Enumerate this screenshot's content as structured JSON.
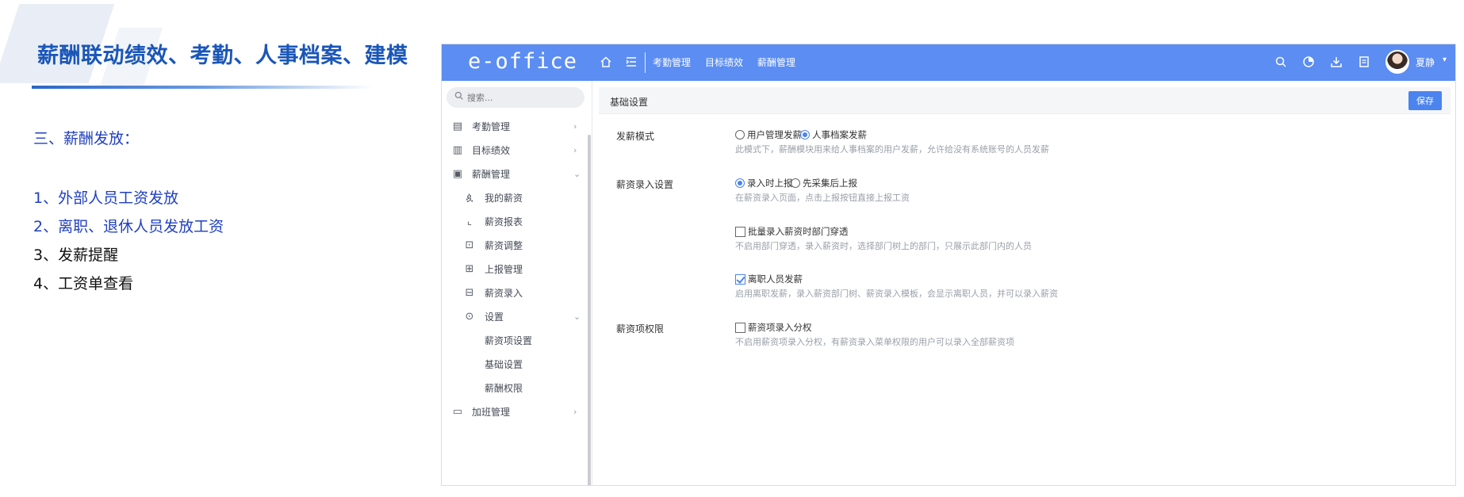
{
  "slide": {
    "title": "薪酬联动绩效、考勤、人事档案、建模",
    "section_heading": "三、薪酬发放：",
    "points": [
      {
        "text": "1、外部人员工资发放",
        "color": "#2040c0"
      },
      {
        "text": "2、离职、退休人员发放工资",
        "color": "#2040c0"
      },
      {
        "text": "3、发薪提醒",
        "color": "#111111"
      },
      {
        "text": "4、工资单查看",
        "color": "#111111"
      }
    ]
  },
  "app": {
    "logo": "e-office",
    "accent_color": "#5b8df2",
    "topbar": {
      "nav": [
        "考勤管理",
        "目标绩效",
        "薪酬管理"
      ],
      "icons": [
        "home-icon",
        "menu-list-icon",
        "search-icon",
        "pie-chart-icon",
        "download-icon",
        "document-icon"
      ],
      "username": "夏静",
      "caret": "▾"
    },
    "sidebar": {
      "search_placeholder": "搜索...",
      "items": [
        {
          "label": "考勤管理",
          "icon": "clipboard-icon",
          "arrow": "›"
        },
        {
          "label": "目标绩效",
          "icon": "bar-chart-icon",
          "arrow": "›"
        },
        {
          "label": "薪酬管理",
          "icon": "wallet-icon",
          "arrow": "⌄"
        },
        {
          "label": "我的薪资",
          "icon": "user-icon"
        },
        {
          "label": "薪资报表",
          "icon": "line-chart-icon"
        },
        {
          "label": "薪资调整",
          "icon": "adjust-icon"
        },
        {
          "label": "上报管理",
          "icon": "report-icon"
        },
        {
          "label": "薪资录入",
          "icon": "entry-icon"
        },
        {
          "label": "设置",
          "icon": "settings-icon",
          "arrow": "⌄"
        },
        {
          "label": "薪资项设置"
        },
        {
          "label": "基础设置"
        },
        {
          "label": "薪酬权限"
        },
        {
          "label": "加班管理",
          "icon": "calendar-icon",
          "arrow": "›"
        }
      ]
    },
    "content": {
      "title": "基础设置",
      "save_label": "保存",
      "pay_mode": {
        "label": "发薪模式",
        "options": [
          "用户管理发薪",
          "人事档案发薪"
        ],
        "selected": "人事档案发薪",
        "hint": "此模式下，薪酬模块用来给人事档案的用户发薪，允许给没有系统账号的人员发薪"
      },
      "entry_settings": {
        "label": "薪资录入设置",
        "options": [
          "录入时上报",
          "先采集后上报"
        ],
        "selected": "录入时上报",
        "hint": "在薪资录入页面，点击上报按钮直接上报工资",
        "batch_checkbox": {
          "label": "批量录入薪资时部门穿透",
          "checked": false,
          "hint": "不启用部门穿透，录入薪资时，选择部门树上的部门，只展示此部门内的人员"
        },
        "resigned_checkbox": {
          "label": "离职人员发薪",
          "checked": true,
          "hint": "启用离职发薪，录入薪资部门树、薪资录入模板，会显示离职人员，并可以录入薪资"
        }
      },
      "permission": {
        "label": "薪资项权限",
        "checkbox": {
          "label": "薪资项录入分权",
          "checked": false,
          "hint": "不启用薪资项录入分权，有薪资录入菜单权限的用户可以录入全部薪资项"
        }
      }
    }
  }
}
